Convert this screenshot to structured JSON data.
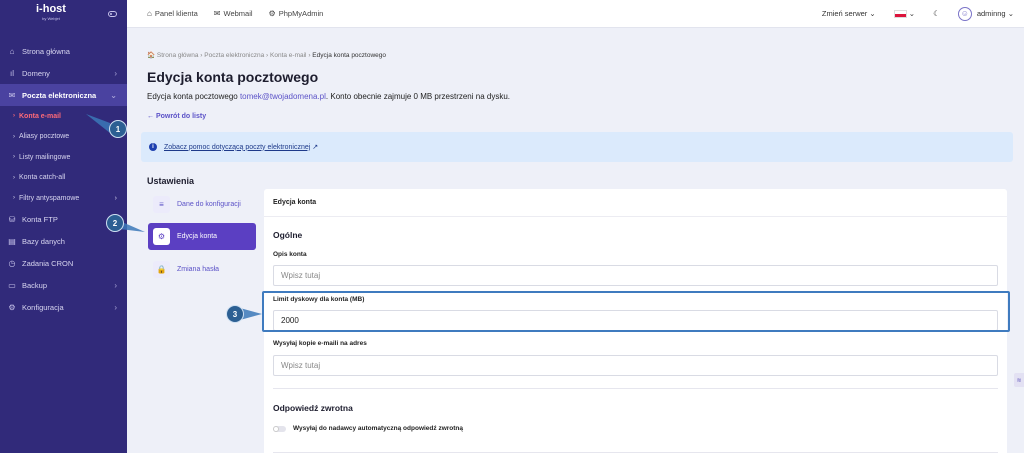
{
  "sidebar": {
    "logo": "i-host",
    "logo_sub": "by Webjet",
    "items": [
      {
        "label": "Strona główna",
        "icon": "⌂"
      },
      {
        "label": "Domeny",
        "icon": "ıl",
        "chevron": "›"
      },
      {
        "label": "Poczta elektroniczna",
        "icon": "✉",
        "chevron": "⌄"
      },
      {
        "label": "Konta FTP",
        "icon": "⛁"
      },
      {
        "label": "Bazy danych",
        "icon": "▤"
      },
      {
        "label": "Zadania CRON",
        "icon": "◷"
      },
      {
        "label": "Backup",
        "icon": "▭",
        "chevron": "›"
      },
      {
        "label": "Konfiguracja",
        "icon": "⚙",
        "chevron": "›"
      }
    ],
    "subitems": [
      {
        "label": "Konta e-mail"
      },
      {
        "label": "Aliasy pocztowe"
      },
      {
        "label": "Listy mailingowe"
      },
      {
        "label": "Konta catch-all"
      },
      {
        "label": "Filtry antyspamowe",
        "chevron": "›"
      }
    ]
  },
  "topbar": {
    "links": [
      {
        "label": "Panel klienta",
        "icon": "⌂"
      },
      {
        "label": "Webmail",
        "icon": "✉"
      },
      {
        "label": "PhpMyAdmin",
        "icon": "⚙"
      }
    ],
    "server_label": "Zmień serwer",
    "theme_icon": "☾",
    "user": "adminng"
  },
  "breadcrumb": {
    "items": [
      "Strona główna",
      "Poczta elektroniczna",
      "Konta e-mail"
    ],
    "current": "Edycja konta pocztowego"
  },
  "page": {
    "title": "Edycja konta pocztowego",
    "desc_prefix": "Edycja konta pocztowego ",
    "email": "tomek@twojadomena.pl",
    "desc_suffix": ". Konto obecnie zajmuje 0 MB przestrzeni na dysku.",
    "back": "← Powrót do listy"
  },
  "info": {
    "link": "Zobacz pomoc dotyczącą poczty elektronicznej",
    "ext_icon": "↗"
  },
  "settings": {
    "title": "Ustawienia",
    "tabs": [
      {
        "label": "Dane do konfiguracji",
        "icon": "≡"
      },
      {
        "label": "Edycja konta",
        "icon": "⚙"
      },
      {
        "label": "Zmiana hasła",
        "icon": "🔒"
      }
    ]
  },
  "form": {
    "card_title": "Edycja konta",
    "general_title": "Ogólne",
    "desc_label": "Opis konta",
    "desc_placeholder": "Wpisz tutaj",
    "quota_label": "Limit dyskowy dla konta (MB)",
    "quota_value": "2000",
    "copy_label": "Wysyłaj kopie e-maili na adres",
    "copy_placeholder": "Wpisz tutaj",
    "autoreply_title": "Odpowiedź zwrotna",
    "autoreply_toggle_label": "Wysyłaj do nadawcy automatyczną odpowiedź zwrotną"
  },
  "annotations": {
    "b1": "1",
    "b2": "2",
    "b3": "3"
  },
  "colors": {
    "sidebar": "#312a7a",
    "accent": "#5b3fc2",
    "annotation": "#2c5f93"
  }
}
